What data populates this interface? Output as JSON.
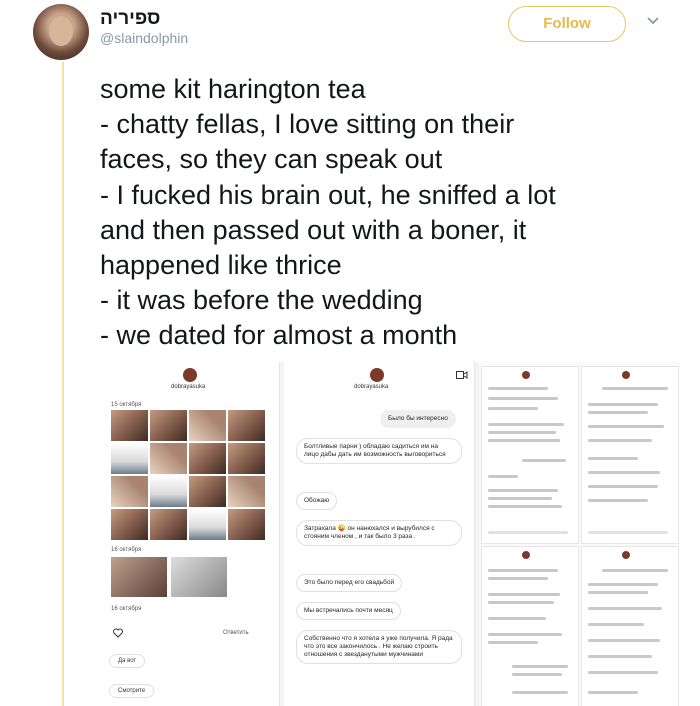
{
  "user": {
    "display_name": "ספיריה",
    "handle": "@slaindolphin",
    "follow_label": "Follow"
  },
  "tweet": {
    "lines": [
      "some kit harington tea",
      "- chatty fellas, I love sitting on their",
      "faces, so they can speak out",
      "- I fucked his brain out, he sniffed a lot",
      "and then passed out with a boner, it",
      "happened like thrice",
      "- it was before the wedding",
      "- we dated for almost a month"
    ]
  },
  "media": {
    "panel1": {
      "username": "dobrayasuka",
      "date1": "15 октября",
      "date2": "16 октября",
      "date3": "16 октября",
      "reply_label": "Ответить",
      "msg_a": "Да вот",
      "msg_b": "Смотрите"
    },
    "panel2": {
      "username": "dobrayasuka",
      "messages": [
        "Было бы интересно",
        "Болтливые парни ) обладаю садиться им на лицо дабы дать им возможность выговориться",
        "Обожаю",
        "Затрахала 😜 он нанюхался и вырубился с стояним членом , и так было 3 раза .",
        "Это было перед его свадьбой",
        "Мы встречались почти месяц",
        "Собственно что я хотела я уже получила. Я рада что это все закончилось . Не желаю строить отношения с звезданутыми мужчинами"
      ]
    }
  }
}
